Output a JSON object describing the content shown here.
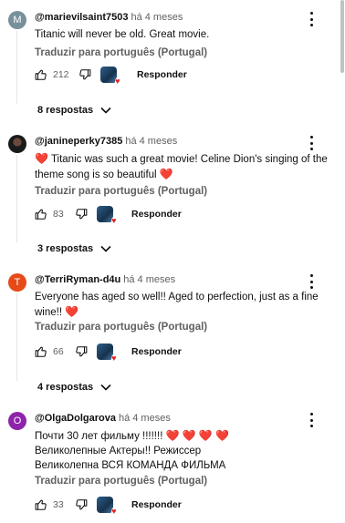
{
  "comments": [
    {
      "avatar_letter": "M",
      "avatar_color": "#78909c",
      "handle": "@marievilsaint7503",
      "time": "há 4 meses",
      "lines": [
        "Titanic  will    never  be old. Great  movie."
      ],
      "translate": "Traduzir para português (Portugal)",
      "likes": "212",
      "reply_label": "Responder",
      "replies_label": "8 respostas"
    },
    {
      "avatar_letter": "",
      "avatar_color": "#1a1a1a",
      "handle": "@janineperky7385",
      "time": "há 4 meses",
      "lines": [
        "❤️  Titanic was such a great movie!  Celine Dion's singing of the",
        "theme song is so beautiful ❤️"
      ],
      "translate": "Traduzir para português (Portugal)",
      "likes": "83",
      "reply_label": "Responder",
      "replies_label": "3 respostas"
    },
    {
      "avatar_letter": "T",
      "avatar_color": "#e64a19",
      "handle": "@TerriRyman-d4u",
      "time": "há 4 meses",
      "lines": [
        "Everyone has aged so well!! Aged to perfection, just as a fine",
        "wine!! ❤️"
      ],
      "translate": "Traduzir para português (Portugal)",
      "likes": "66",
      "reply_label": "Responder",
      "replies_label": "4 respostas"
    },
    {
      "avatar_letter": "O",
      "avatar_color": "#8e24aa",
      "handle": "@OlgaDolgarova",
      "time": "há 4 meses",
      "lines": [
        "Почти 30 лет фильму !!!!!!! ❤️ ❤️ ❤️ ❤️",
        "Великолепные Актеры!! Режиссер",
        "Великолепна  ВСЯ КОМАНДА ФИЛЬМА"
      ],
      "translate": "Traduzir para português (Portugal)",
      "likes": "33",
      "reply_label": "Responder",
      "replies_label": ""
    }
  ],
  "icons": {
    "like": "thumb-up-icon",
    "dislike": "thumb-down-icon",
    "more": "more-vert-icon",
    "expand": "chevron-down-icon",
    "creator_heart": "creator-heart-icon"
  }
}
